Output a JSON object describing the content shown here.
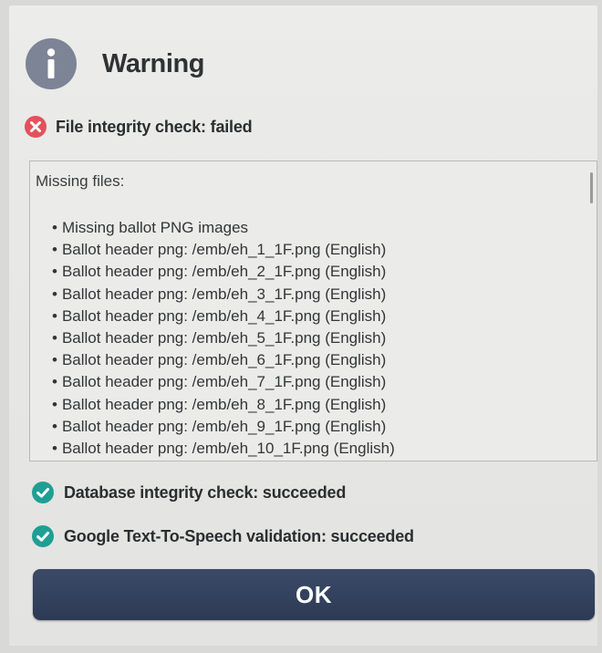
{
  "dialog": {
    "title": "Warning",
    "icon": "info-icon",
    "colors": {
      "info_icon": "#7c8495",
      "fail": "#e0525c",
      "success": "#1f9f94",
      "button": "#34425e"
    }
  },
  "file_check": {
    "icon": "error-icon",
    "text": "File integrity check: failed"
  },
  "missing": {
    "header": "Missing files:",
    "items": [
      "Missing ballot PNG images",
      "Ballot header png: /emb/eh_1_1F.png (English)",
      "Ballot header png: /emb/eh_2_1F.png (English)",
      "Ballot header png: /emb/eh_3_1F.png (English)",
      "Ballot header png: /emb/eh_4_1F.png (English)",
      "Ballot header png: /emb/eh_5_1F.png (English)",
      "Ballot header png: /emb/eh_6_1F.png (English)",
      "Ballot header png: /emb/eh_7_1F.png (English)",
      "Ballot header png: /emb/eh_8_1F.png (English)",
      "Ballot header png: /emb/eh_9_1F.png (English)",
      "Ballot header png: /emb/eh_10_1F.png (English)"
    ]
  },
  "database_check": {
    "icon": "check-circle-icon",
    "text": "Database integrity check: succeeded"
  },
  "tts_check": {
    "icon": "check-circle-icon",
    "text": "Google Text-To-Speech validation: succeeded"
  },
  "ok_button": {
    "label": "OK"
  }
}
